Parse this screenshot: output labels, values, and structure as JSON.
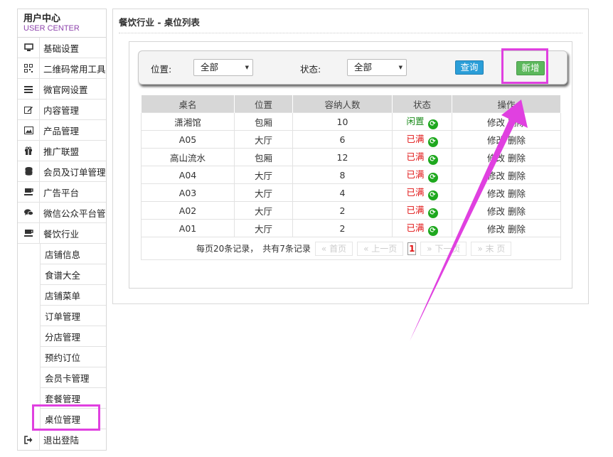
{
  "sidebar": {
    "title": "用户中心",
    "subtitle": "USER CENTER",
    "items": [
      {
        "icon": "monitor-icon",
        "label": "基础设置"
      },
      {
        "icon": "qrcode-icon",
        "label": "二维码常用工具"
      },
      {
        "icon": "list-icon",
        "label": "微官网设置"
      },
      {
        "icon": "edit-icon",
        "label": "内容管理"
      },
      {
        "icon": "image-icon",
        "label": "产品管理"
      },
      {
        "icon": "gift-icon",
        "label": "推广联盟"
      },
      {
        "icon": "database-icon",
        "label": "会员及订单管理"
      },
      {
        "icon": "cup-icon",
        "label": "广告平台"
      },
      {
        "icon": "chat-icon",
        "label": "微信公众平台管"
      },
      {
        "icon": "cup-icon",
        "label": "餐饮行业"
      }
    ],
    "sub_items": [
      "店铺信息",
      "食谱大全",
      "店铺菜单",
      "订单管理",
      "分店管理",
      "预约订位",
      "会员卡管理",
      "套餐管理",
      "桌位管理"
    ],
    "logout": {
      "icon": "logout-icon",
      "label": "退出登陆"
    }
  },
  "main": {
    "title": "餐饮行业 - 桌位列表",
    "filter": {
      "location_label": "位置:",
      "location_value": "全部",
      "status_label": "状态:",
      "status_value": "全部",
      "query_label": "查询",
      "add_label": "新增"
    },
    "table": {
      "headers": [
        "桌名",
        "位置",
        "容纳人数",
        "状态",
        "操作"
      ],
      "rows": [
        {
          "name": "潇湘馆",
          "location": "包厢",
          "capacity": "10",
          "status": "闲置",
          "free": true
        },
        {
          "name": "A05",
          "location": "大厅",
          "capacity": "6",
          "status": "已满",
          "free": false
        },
        {
          "name": "高山流水",
          "location": "包厢",
          "capacity": "12",
          "status": "已满",
          "free": false
        },
        {
          "name": "A04",
          "location": "大厅",
          "capacity": "8",
          "status": "已满",
          "free": false
        },
        {
          "name": "A03",
          "location": "大厅",
          "capacity": "4",
          "status": "已满",
          "free": false
        },
        {
          "name": "A02",
          "location": "大厅",
          "capacity": "2",
          "status": "已满",
          "free": false
        },
        {
          "name": "A01",
          "location": "大厅",
          "capacity": "2",
          "status": "已满",
          "free": false
        }
      ],
      "edit_label": "修改",
      "delete_label": "删除"
    },
    "pager": {
      "per_page": "每页20条记录，",
      "total": "共有7条记录",
      "first": "« 首页",
      "prev": "« 上一页",
      "current": "1",
      "next": "» 下一页",
      "last": "» 末 页"
    }
  },
  "annotation_color": "#e040e0"
}
